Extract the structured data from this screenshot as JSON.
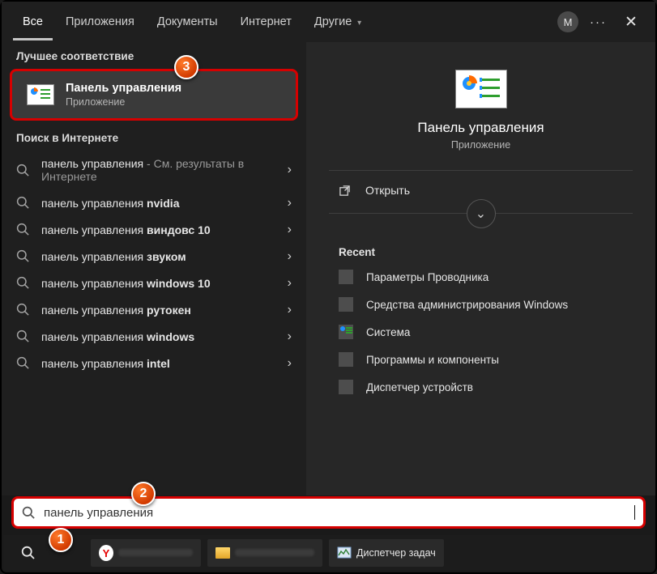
{
  "tabs": {
    "all": "Все",
    "apps": "Приложения",
    "docs": "Документы",
    "web": "Интернет",
    "more": "Другие"
  },
  "avatar_initial": "M",
  "sections": {
    "best_match": "Лучшее соответствие",
    "web_search": "Поиск в Интернете"
  },
  "best_match": {
    "title": "Панель управления",
    "subtitle": "Приложение"
  },
  "web_results": [
    {
      "prefix": "панель управления",
      "bold": "",
      "hint": " - См. результаты в Интернете"
    },
    {
      "prefix": "панель управления ",
      "bold": "nvidia",
      "hint": ""
    },
    {
      "prefix": "панель управления ",
      "bold": "виндовс 10",
      "hint": ""
    },
    {
      "prefix": "панель управления ",
      "bold": "звуком",
      "hint": ""
    },
    {
      "prefix": "панель управления ",
      "bold": "windows 10",
      "hint": ""
    },
    {
      "prefix": "панель управления ",
      "bold": "рутокен",
      "hint": ""
    },
    {
      "prefix": "панель управления ",
      "bold": "windows",
      "hint": ""
    },
    {
      "prefix": "панель управления ",
      "bold": "intel",
      "hint": ""
    }
  ],
  "preview": {
    "title": "Панель управления",
    "subtitle": "Приложение",
    "open": "Открыть",
    "recent_label": "Recent"
  },
  "recent": [
    "Параметры Проводника",
    "Средства администрирования Windows",
    "Система",
    "Программы и компоненты",
    "Диспетчер устройств"
  ],
  "search": {
    "value": "панель управления"
  },
  "taskbar": {
    "apps": [
      {
        "label": "Диспетчер задач",
        "clear": true
      }
    ]
  },
  "badges": {
    "b1": "1",
    "b2": "2",
    "b3": "3"
  }
}
